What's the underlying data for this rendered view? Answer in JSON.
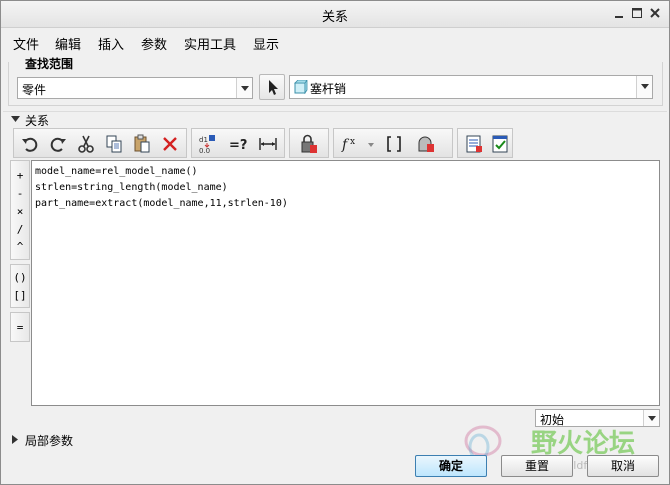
{
  "window": {
    "title": "关系"
  },
  "menu": [
    "文件",
    "编辑",
    "插入",
    "参数",
    "实用工具",
    "显示"
  ],
  "find_scope": {
    "title": "查找范围",
    "type_value": "零件",
    "object_value": "塞杆销"
  },
  "relations": {
    "section_label": "关系",
    "side_ops": [
      "+",
      "-",
      "×",
      "/",
      "^",
      "()",
      "[]",
      "="
    ],
    "code_lines": [
      "model_name=rel_model_name()",
      "strlen=string_length(model_name)",
      "part_name=extract(model_name,11,strlen-10)"
    ]
  },
  "sort_combo": {
    "value": "初始"
  },
  "local_params": {
    "label": "局部参数"
  },
  "buttons": {
    "ok": "确定",
    "reset": "重置",
    "cancel": "取消"
  },
  "watermark": {
    "text": "野火论坛",
    "url": "www.proewildfire.cn"
  },
  "icons": {
    "toolbar": [
      "undo-icon",
      "redo-icon",
      "cut-icon",
      "copy-icon",
      "paste-icon",
      "delete-icon",
      "switch-symbols-icon",
      "evaluate-icon",
      "show-dimension-icon",
      "lock-parameter-icon",
      "insert-function-icon",
      "insert-parameter-icon",
      "units-icon",
      "sort-relations-icon",
      "verify-relations-icon"
    ]
  },
  "colors": {
    "primary_button": "#bee6fd",
    "watermark": "#50be28"
  }
}
